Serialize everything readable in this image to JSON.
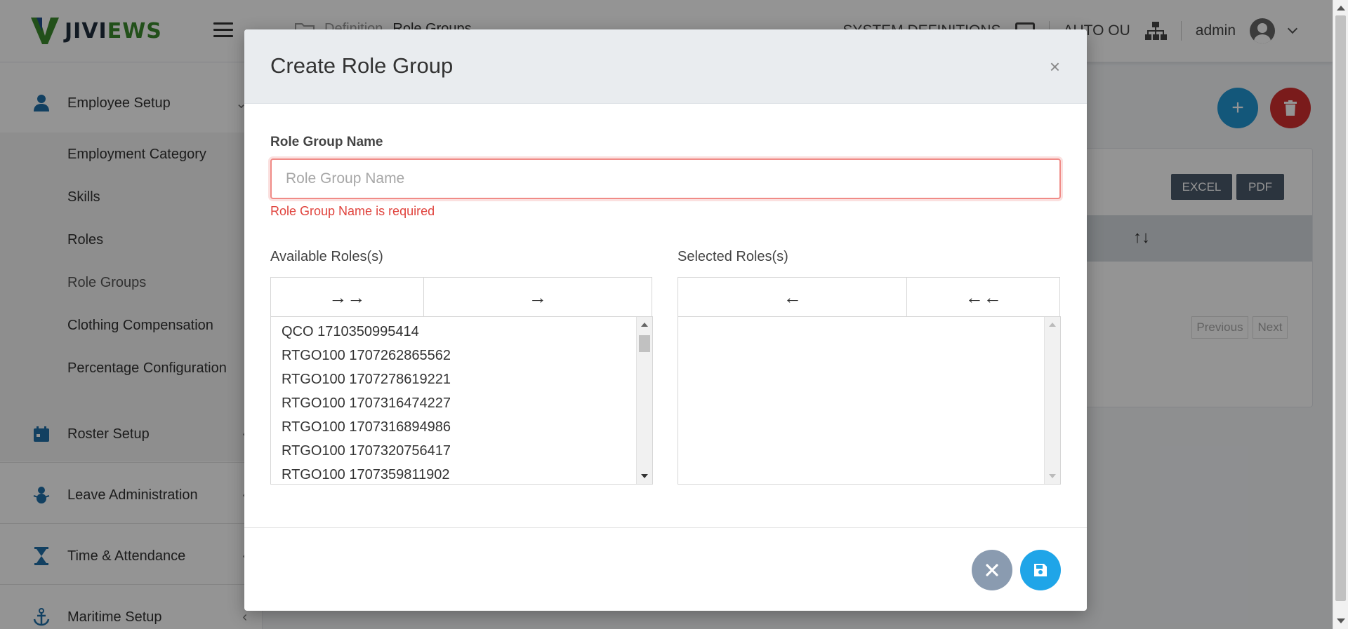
{
  "app": {
    "logo_text_a": "JIVI",
    "logo_text_b": "EWS"
  },
  "breadcrumb": {
    "parent": "Definition",
    "current": "Role Groups"
  },
  "top_nav": {
    "system_definitions": "SYSTEM DEFINITIONS",
    "org_unit": "AUTO OU",
    "user": "admin"
  },
  "sidebar": {
    "groups": [
      {
        "label": "Employee Setup",
        "icon": "person-icon"
      },
      {
        "label": "Roster Setup",
        "icon": "calendar-icon"
      },
      {
        "label": "Leave Administration",
        "icon": "snowman-icon"
      },
      {
        "label": "Time & Attendance",
        "icon": "hourglass-icon"
      },
      {
        "label": "Maritime Setup",
        "icon": "anchor-icon"
      }
    ],
    "sub_items": [
      "Employment Category",
      "Skills",
      "Roles",
      "Role Groups",
      "Clothing Compensation",
      "Percentage Configuration"
    ]
  },
  "background": {
    "excel_label": "EXCEL",
    "pdf_label": "PDF",
    "sort_glyph": "↑↓",
    "previous_label": "Previous",
    "next_label": "Next"
  },
  "modal": {
    "title": "Create Role Group",
    "close_glyph": "×",
    "field_label": "Role Group Name",
    "field_placeholder": "Role Group Name",
    "field_value": "",
    "error_text": "Role Group Name is required",
    "available_title": "Available Roles(s)",
    "selected_title": "Selected Roles(s)",
    "move_all_right": "→→",
    "move_right": "→",
    "move_left": "←",
    "move_all_left": "←←",
    "available_roles": [
      "QCO 1710350995414",
      "RTGO100 1707262865562",
      "RTGO100 1707278619221",
      "RTGO100 1707316474227",
      "RTGO100 1707316894986",
      "RTGO100 1707320756417",
      "RTGO100 1707359811902"
    ],
    "selected_roles": []
  },
  "colors": {
    "primary": "#1fa5e8",
    "danger": "#e0433d",
    "cancel": "#8a9bb0",
    "brand_green": "#3c8a2e"
  }
}
